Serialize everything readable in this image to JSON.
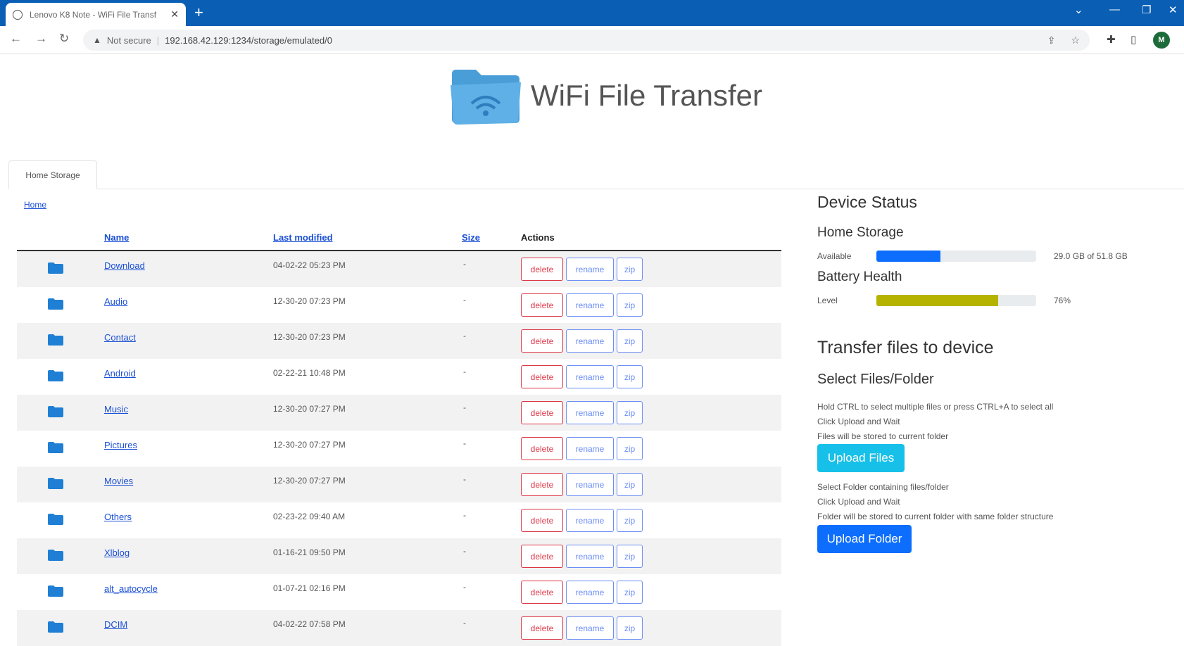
{
  "browser": {
    "tab_title": "Lenovo K8 Note - WiFi File Transf",
    "not_secure": "Not secure",
    "url": "192.168.42.129:1234/storage/emulated/0",
    "avatar_initial": "M"
  },
  "header": {
    "title": "WiFi File Transfer"
  },
  "tabs": {
    "home_storage": "Home Storage"
  },
  "breadcrumb": "Home",
  "table": {
    "headers": {
      "name": "Name",
      "last_modified": "Last modified",
      "size": "Size",
      "actions": "Actions"
    },
    "buttons": {
      "delete": "delete",
      "rename": "rename",
      "zip": "zip"
    },
    "rows": [
      {
        "name": "Download",
        "modified": "04-02-22 05:23 PM",
        "size": "-"
      },
      {
        "name": "Audio",
        "modified": "12-30-20 07:23 PM",
        "size": "-"
      },
      {
        "name": "Contact",
        "modified": "12-30-20 07:23 PM",
        "size": "-"
      },
      {
        "name": "Android",
        "modified": "02-22-21 10:48 PM",
        "size": "-"
      },
      {
        "name": "Music",
        "modified": "12-30-20 07:27 PM",
        "size": "-"
      },
      {
        "name": "Pictures",
        "modified": "12-30-20 07:27 PM",
        "size": "-"
      },
      {
        "name": "Movies",
        "modified": "12-30-20 07:27 PM",
        "size": "-"
      },
      {
        "name": "Others",
        "modified": "02-23-22 09:40 AM",
        "size": "-"
      },
      {
        "name": "Xlblog",
        "modified": "01-16-21 09:50 PM",
        "size": "-"
      },
      {
        "name": "alt_autocycle",
        "modified": "01-07-21 02:16 PM",
        "size": "-"
      },
      {
        "name": "DCIM",
        "modified": "04-02-22 07:58 PM",
        "size": "-"
      }
    ]
  },
  "device_status": {
    "title": "Device Status",
    "storage_title": "Home Storage",
    "storage_label": "Available",
    "storage_text": "29.0 GB of 51.8 GB",
    "storage_fraction": 0.4,
    "battery_title": "Battery Health",
    "battery_label": "Level",
    "battery_text": "76%",
    "battery_fraction": 0.76
  },
  "transfer": {
    "title": "Transfer files to device",
    "select_title": "Select Files/Folder",
    "files_note_1": "Hold CTRL to select multiple files or press CTRL+A to select all",
    "files_note_2": "Click Upload and Wait",
    "files_note_3": "Files will be stored to current folder",
    "upload_files": "Upload Files",
    "folder_note_1": "Select Folder containing files/folder",
    "folder_note_2": "Click Upload and Wait",
    "folder_note_3": "Folder will be stored to current folder with same folder structure",
    "upload_folder": "Upload Folder"
  },
  "colors": {
    "chrome_blue": "#0a5fb4",
    "link": "#1a4fd6",
    "danger": "#dc3545",
    "storage_bar": "#0d6efd",
    "battery_bar": "#b5b300",
    "upload_files_bg": "#17c0e8",
    "upload_folder_bg": "#0d6efd"
  }
}
